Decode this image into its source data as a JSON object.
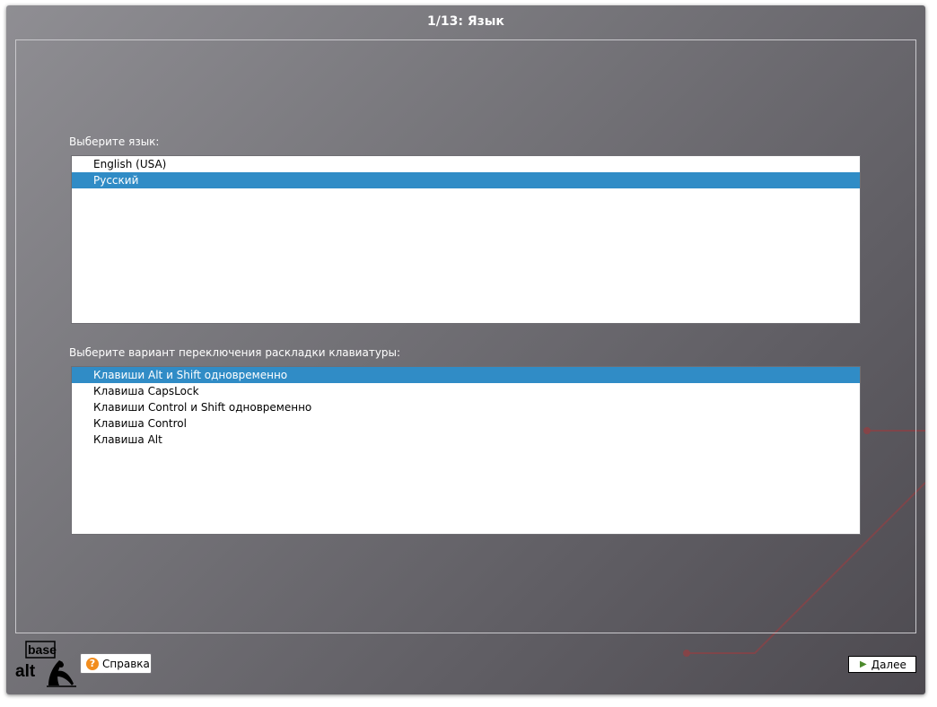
{
  "window": {
    "title": "1/13: Язык"
  },
  "language": {
    "label": "Выберите язык:",
    "items": [
      {
        "label": "English (USA)",
        "selected": false
      },
      {
        "label": "Русский",
        "selected": true
      }
    ]
  },
  "keyboard": {
    "label": "Выберите вариант переключения раскладки клавиатуры:",
    "items": [
      {
        "label": "Клавиши Alt и Shift одновременно",
        "selected": true
      },
      {
        "label": "Клавиша CapsLock",
        "selected": false
      },
      {
        "label": "Клавиши Control и Shift одновременно",
        "selected": false
      },
      {
        "label": "Клавиша Control",
        "selected": false
      },
      {
        "label": "Клавиша Alt",
        "selected": false
      }
    ]
  },
  "footer": {
    "logo_text_top": "base",
    "logo_text_bottom": "alt",
    "help_label": "Справка",
    "next_label": "Далее"
  },
  "colors": {
    "selection": "#308cc6",
    "help_icon": "#f28d1e",
    "next_icon": "#4c8a2c",
    "decoration": "#a0484a"
  },
  "icons": {
    "help": "question-circle-icon",
    "next": "chevron-right-icon"
  }
}
